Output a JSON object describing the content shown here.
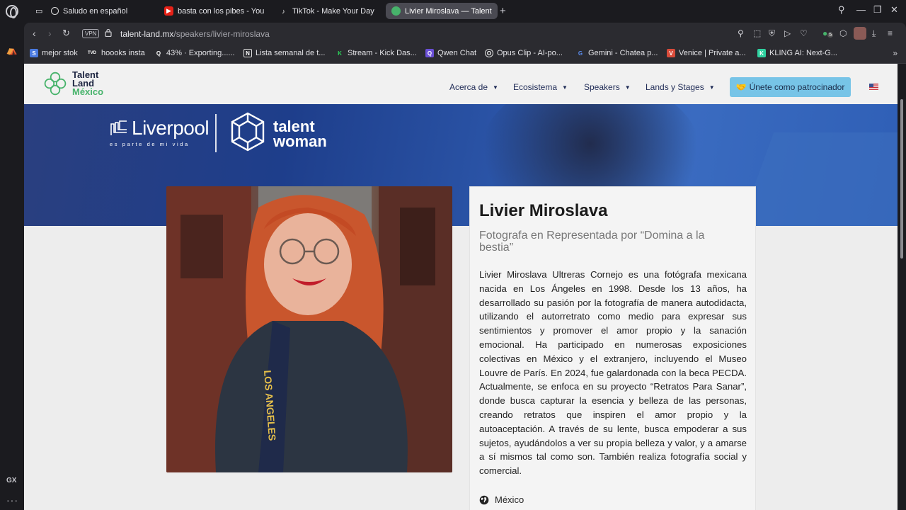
{
  "browser": {
    "tabs": [
      {
        "title": "Saludo en español",
        "favicon_color": "#2b2b30"
      },
      {
        "title": "basta con los pibes - You",
        "favicon_color": "#e62117"
      },
      {
        "title": "TikTok - Make Your Day",
        "favicon_color": "#2b2b30"
      },
      {
        "title": "Livier Miroslava — Talent",
        "favicon_color": "#47b36b"
      }
    ],
    "url_host": "talent-land.mx",
    "url_path": "/speakers/livier-miroslava",
    "vpn_label": "VPN",
    "extension_badge": "5",
    "sidebar_label": "GX",
    "bookmarks": [
      {
        "label": "mejor stok",
        "favicon": "S",
        "color": "#4a7ae0"
      },
      {
        "label": "hoooks insta",
        "favicon": "TVD",
        "color": "#2b2b30"
      },
      {
        "label": "43% · Exporting......",
        "favicon": "Q",
        "color": "#2b2b30"
      },
      {
        "label": "Lista semanal de t...",
        "favicon": "N",
        "color": "#2b2b30"
      },
      {
        "label": "Stream - Kick Das...",
        "favicon": "K",
        "color": "#2ad35a"
      },
      {
        "label": "Qwen Chat",
        "favicon": "Q",
        "color": "#6a4fd6"
      },
      {
        "label": "Opus Clip - AI-po...",
        "favicon": "O",
        "color": "#2b2b30"
      },
      {
        "label": "Gemini - Chatea p...",
        "favicon": "G",
        "color": "#5b8def"
      },
      {
        "label": "Venice | Private a...",
        "favicon": "V",
        "color": "#d94b3a"
      },
      {
        "label": "KLING AI: Next-G...",
        "favicon": "K",
        "color": "#2fd1a0"
      }
    ]
  },
  "site": {
    "logo": {
      "line1": "Talent",
      "line2": "Land",
      "line3": "México"
    },
    "nav": [
      "Acerca de",
      "Ecosistema",
      "Speakers",
      "Lands y Stages"
    ],
    "sponsor_button": "Únete como patrocinador",
    "accent_color": "#77c4e7",
    "banner": {
      "brand": "Liverpool",
      "brand_tagline": "es parte de mi vida",
      "partner_line1": "talent",
      "partner_line2": "woman"
    }
  },
  "speaker": {
    "name": "Livier Miroslava",
    "subtitle": "Fotografa en Representada por “Domina a la bestia”",
    "bio": "Livier Miroslava Ultreras Cornejo es una fotógrafa mexicana nacida en Los Ángeles en 1998. Desde los 13 años, ha desarrollado su pasión por la fotografía de manera autodidacta, utilizando el autorretrato como medio para expresar sus sentimientos y promover el amor propio y la sanación emocional. Ha participado en numerosas exposiciones colectivas en México y el extranjero, incluyendo el Museo Louvre de París. En 2024, fue galardonada con la beca PECDA. Actualmente, se enfoca en su proyecto “Retratos Para Sanar”, donde busca capturar la esencia y belleza de las personas, creando retratos que inspiren el amor propio y la autoaceptación. A través de su lente, busca empoderar a sus sujetos, ayudándolos a ver su propia belleza y valor, y a amarse a sí mismos tal como son. También realiza fotografía social y comercial.",
    "country": "México",
    "photo_strap_text": "LOS ANGELES"
  }
}
